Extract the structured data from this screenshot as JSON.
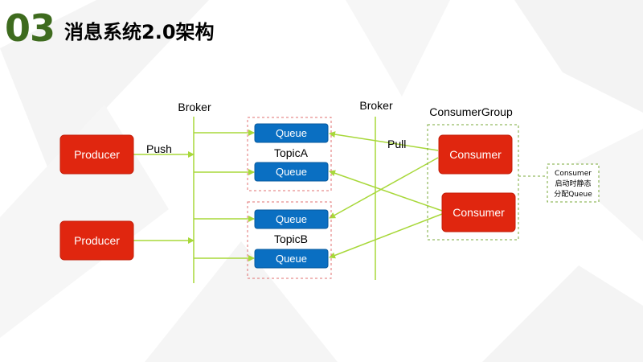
{
  "header": {
    "number": "03",
    "title": "消息系统2.0架构"
  },
  "diagram": {
    "broker_left_label": "Broker",
    "broker_right_label": "Broker",
    "consumer_group_label": "ConsumerGroup",
    "push_label": "Push",
    "pull_label": "Pull",
    "producers": [
      "Producer",
      "Producer"
    ],
    "topics": [
      {
        "name": "TopicA",
        "queues": [
          "Queue",
          "Queue"
        ]
      },
      {
        "name": "TopicB",
        "queues": [
          "Queue",
          "Queue"
        ]
      }
    ],
    "consumers": [
      "Consumer",
      "Consumer"
    ],
    "note_lines": [
      "Consumer",
      "启动时静态",
      "分配Queue"
    ]
  },
  "colors": {
    "producer_red": "#e0260f",
    "queue_blue": "#0a6fc2",
    "arrow_green": "#a8d83a",
    "title_green": "#3e6b1e",
    "dashed_red": "#e07070",
    "dashed_green": "#7aa83a"
  }
}
